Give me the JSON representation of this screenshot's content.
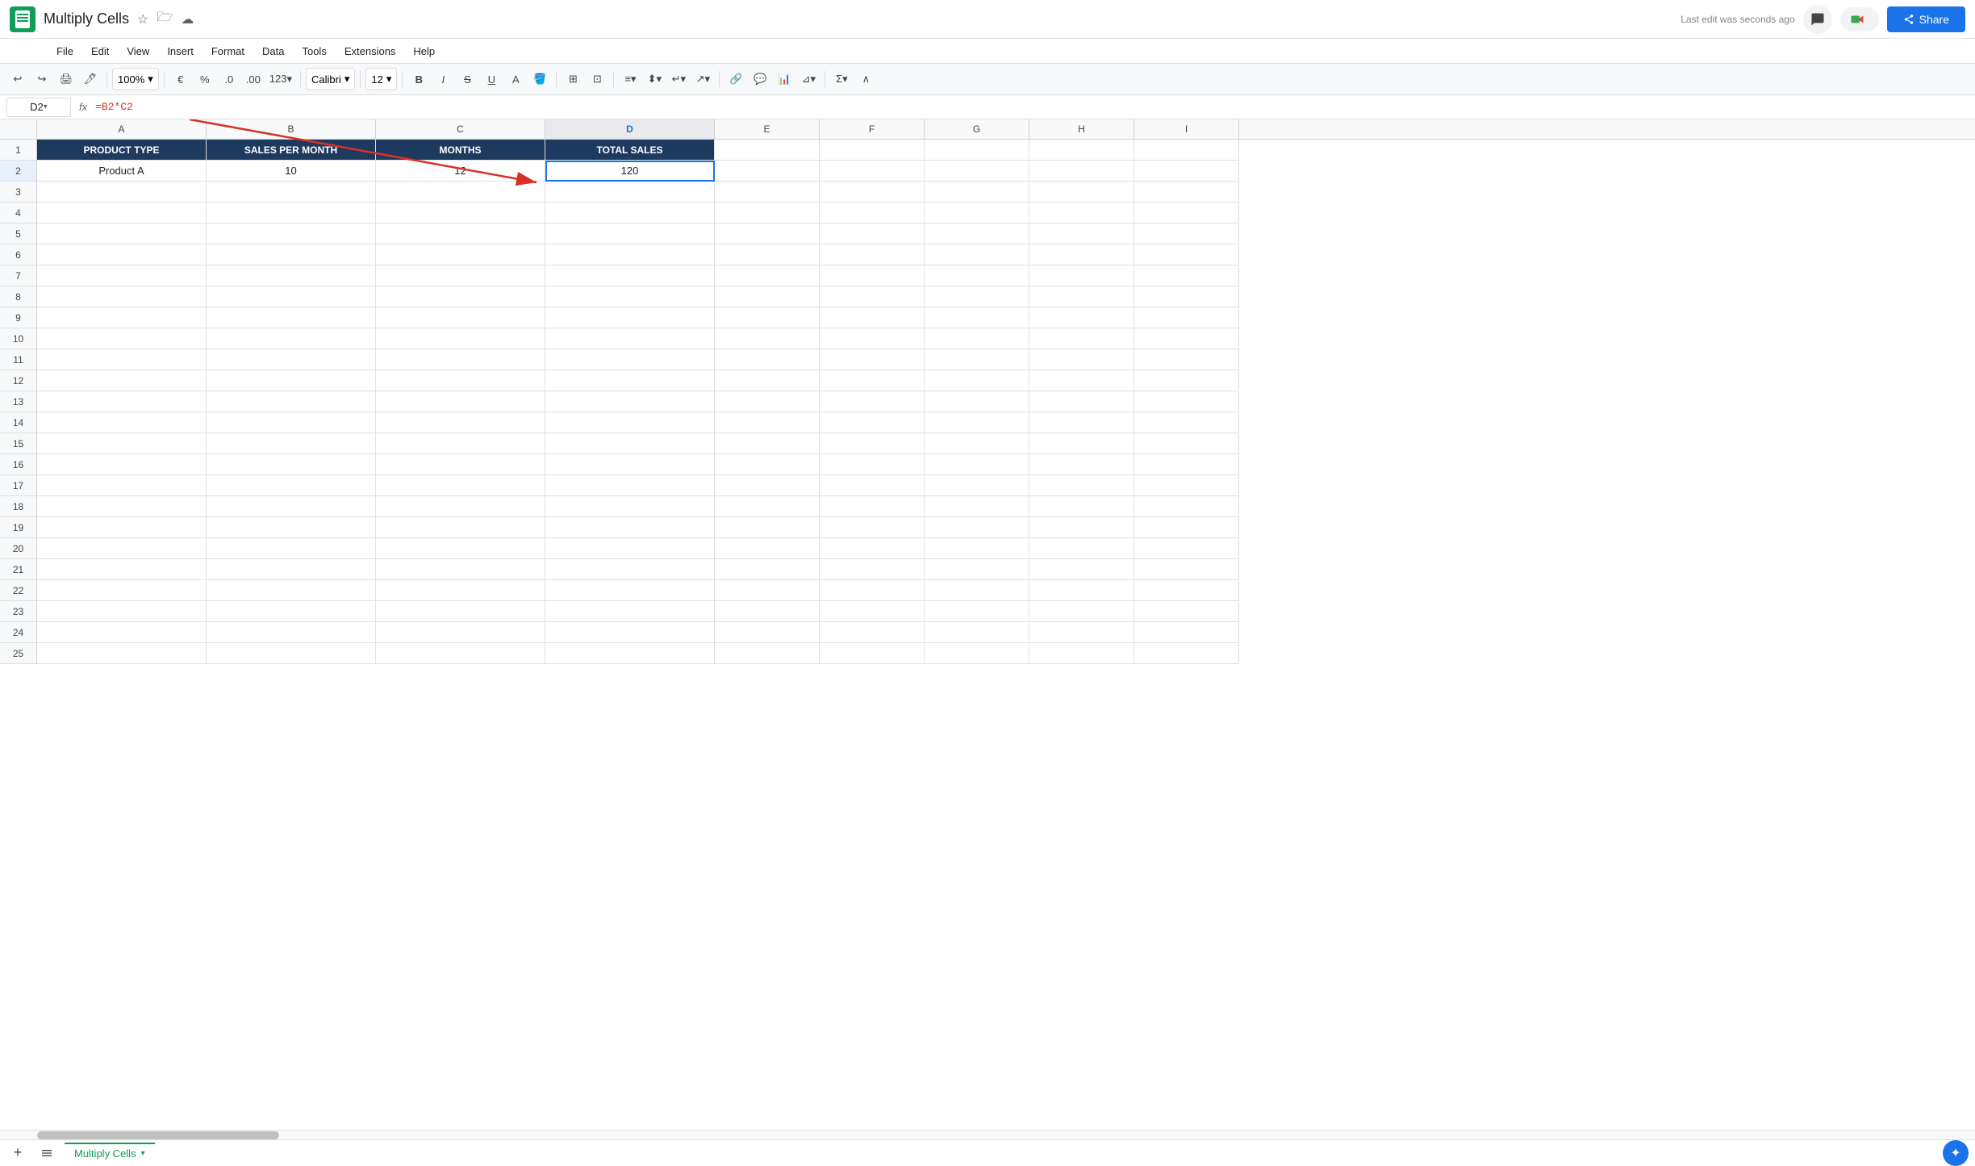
{
  "app": {
    "title": "Multiply Cells",
    "logo_color": "#0f9d58"
  },
  "header": {
    "title": "Multiply Cells",
    "last_edit": "Last edit was seconds ago",
    "share_label": "Share",
    "meet_label": "Meet"
  },
  "menu": {
    "items": [
      "File",
      "Edit",
      "View",
      "Insert",
      "Format",
      "Data",
      "Tools",
      "Extensions",
      "Help"
    ]
  },
  "toolbar": {
    "zoom": "100%",
    "font": "Calibri",
    "font_size": "12"
  },
  "formula_bar": {
    "cell_ref": "D2",
    "formula": "=B2*C2"
  },
  "columns": {
    "headers": [
      "A",
      "B",
      "C",
      "D",
      "E",
      "F",
      "G",
      "H",
      "I"
    ]
  },
  "rows": [
    {
      "num": 1,
      "cells": [
        "PRODUCT TYPE",
        "SALES PER MONTH",
        "MONTHS",
        "TOTAL SALES",
        "",
        "",
        "",
        "",
        ""
      ]
    },
    {
      "num": 2,
      "cells": [
        "Product A",
        "10",
        "12",
        "120",
        "",
        "",
        "",
        "",
        ""
      ]
    }
  ],
  "empty_rows": [
    3,
    4,
    5,
    6,
    7,
    8,
    9,
    10,
    11,
    12,
    13,
    14,
    15,
    16,
    17,
    18,
    19,
    20,
    21,
    22,
    23,
    24,
    25
  ],
  "sheet_tab": {
    "name": "Multiply Cells"
  },
  "selected_cell": "D2",
  "active_col": "D",
  "colors": {
    "header_bg": "#1e3a5f",
    "header_text": "#ffffff",
    "selected_border": "#1a73e8",
    "sheet_tab_color": "#0f9d58"
  }
}
